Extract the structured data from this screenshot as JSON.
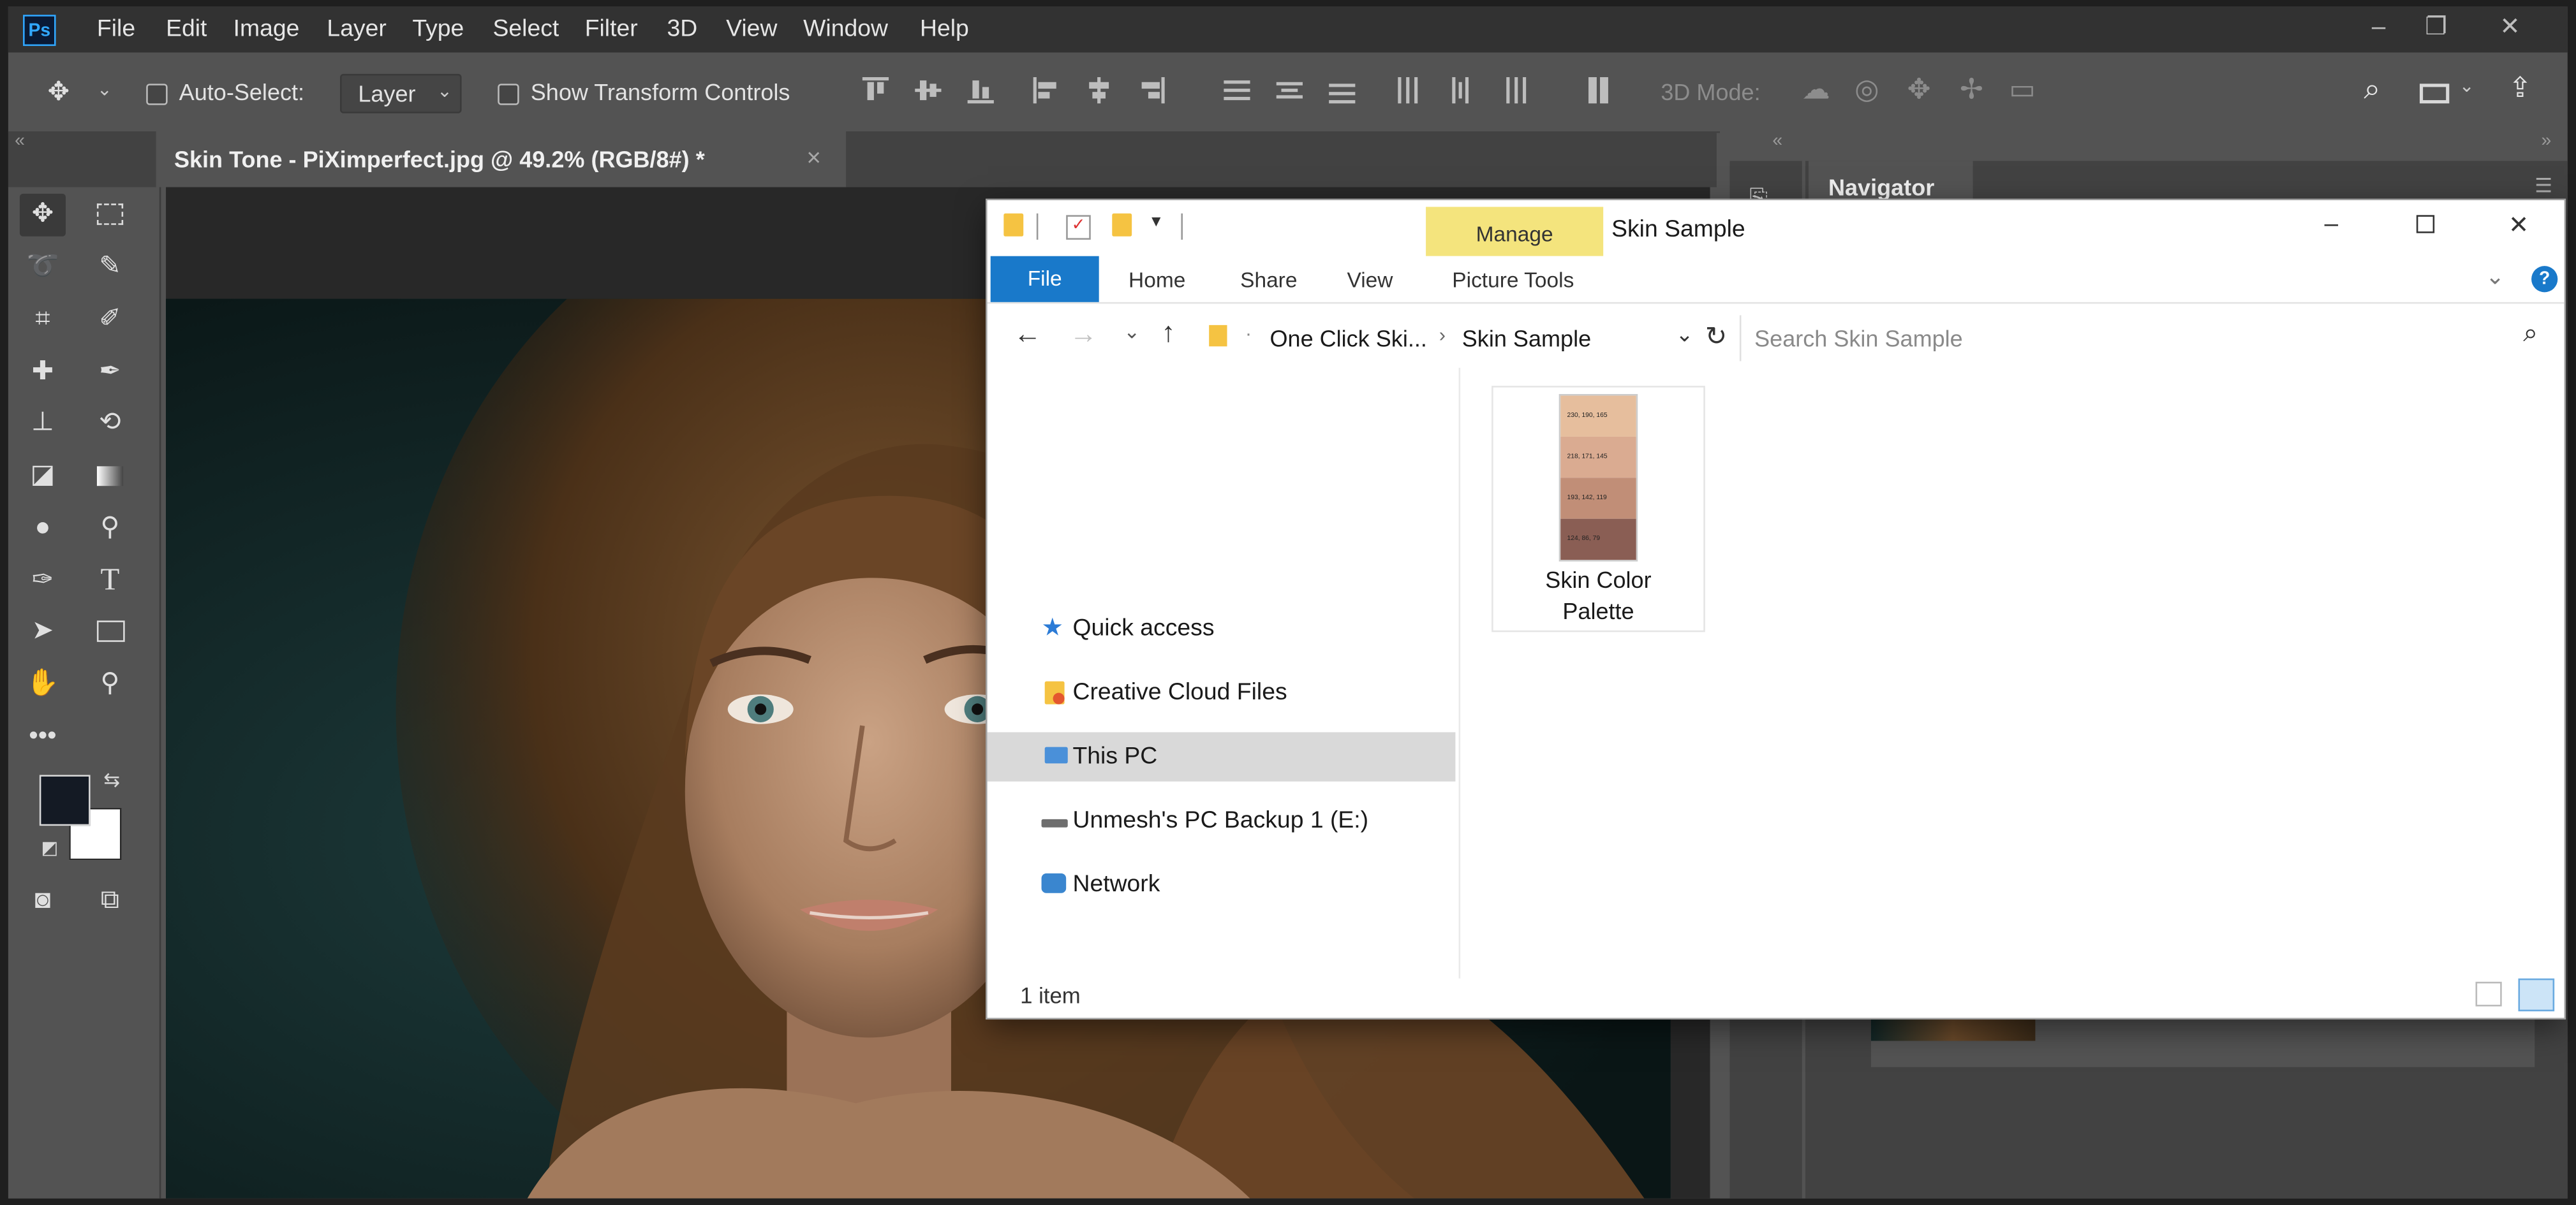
{
  "app": {
    "logo": "Ps",
    "menu": [
      "File",
      "Edit",
      "Image",
      "Layer",
      "Type",
      "Select",
      "Filter",
      "3D",
      "View",
      "Window",
      "Help"
    ],
    "window_controls": {
      "minimize": "–",
      "restore": "❐",
      "close": "✕"
    }
  },
  "options_bar": {
    "auto_select_label": "Auto-Select:",
    "auto_select_value": "Layer",
    "show_transform_label": "Show Transform Controls",
    "mode_3d_label": "3D Mode:"
  },
  "document": {
    "tab_title": "Skin Tone - PiXimperfect.jpg @ 49.2% (RGB/8#) *",
    "tab_close": "×"
  },
  "panels": {
    "navigator_title": "Navigator",
    "collapse_left": "«",
    "collapse_right": "»"
  },
  "explorer": {
    "title": "Skin Sample",
    "manage_tab": "Manage",
    "ribbon_tabs": [
      "File",
      "Home",
      "Share",
      "View",
      "Picture Tools"
    ],
    "help": "?",
    "breadcrumb": [
      "One Click Ski...",
      "Skin Sample"
    ],
    "search_placeholder": "Search Skin Sample",
    "nav_items": [
      "Quick access",
      "Creative Cloud Files",
      "This PC",
      "Unmesh's PC Backup 1 (E:)",
      "Network"
    ],
    "selected_nav": "This PC",
    "files": [
      {
        "name_line1": "Skin Color",
        "name_line2": "Palette",
        "swatches": [
          {
            "label": "230, 190, 165",
            "color": "#e6be9d"
          },
          {
            "label": "218, 171, 145",
            "color": "#daab91"
          },
          {
            "label": "193, 142, 119",
            "color": "#c18e77"
          },
          {
            "label": "124, 86, 79",
            "color": "#8a5e54"
          }
        ]
      }
    ],
    "status": "1 item"
  },
  "colors": {
    "ps_bg": "#535353",
    "ps_dark": "#323232",
    "ps_accent": "#31a8ff",
    "explorer_file_tab": "#1979ca",
    "manage_tab": "#f4e47d",
    "foreground_color": "#141a24",
    "background_color": "#ffffff"
  }
}
